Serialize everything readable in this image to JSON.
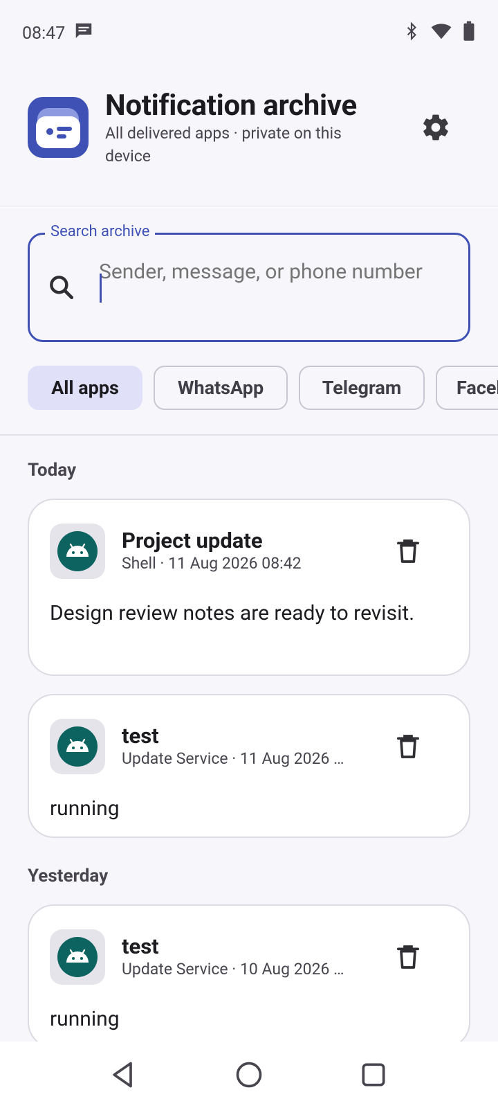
{
  "status_bar": {
    "time": "08:47",
    "icons": [
      "message-icon",
      "bluetooth-icon",
      "wifi-icon",
      "battery-icon"
    ]
  },
  "header": {
    "title": "Notification archive",
    "subtitle": "All delivered apps · private on this device",
    "settings_icon": "gear-icon",
    "accent_color": "#3f51b5"
  },
  "search": {
    "label": "Search archive",
    "placeholder": "Sender, message, or phone number",
    "value": ""
  },
  "filters": {
    "chips": [
      {
        "label": "All apps",
        "selected": true
      },
      {
        "label": "WhatsApp",
        "selected": false
      },
      {
        "label": "Telegram",
        "selected": false
      },
      {
        "label": "Facebook",
        "selected": false
      }
    ]
  },
  "sections": [
    {
      "label": "Today",
      "cards": [
        {
          "title": "Project update",
          "meta": "Shell · 11 Aug 2026 08:42",
          "body": "Design review notes are ready to revisit.",
          "icon": "android-icon"
        },
        {
          "title": "test",
          "meta": "Update Service · 11 Aug 2026 …",
          "body": "running",
          "icon": "android-icon"
        }
      ]
    },
    {
      "label": "Yesterday",
      "cards": [
        {
          "title": "test",
          "meta": "Update Service · 10 Aug 2026 …",
          "body": "running",
          "icon": "android-icon"
        }
      ]
    }
  ],
  "nav_bar": {
    "buttons": [
      "back-icon",
      "home-icon",
      "recents-icon"
    ]
  }
}
